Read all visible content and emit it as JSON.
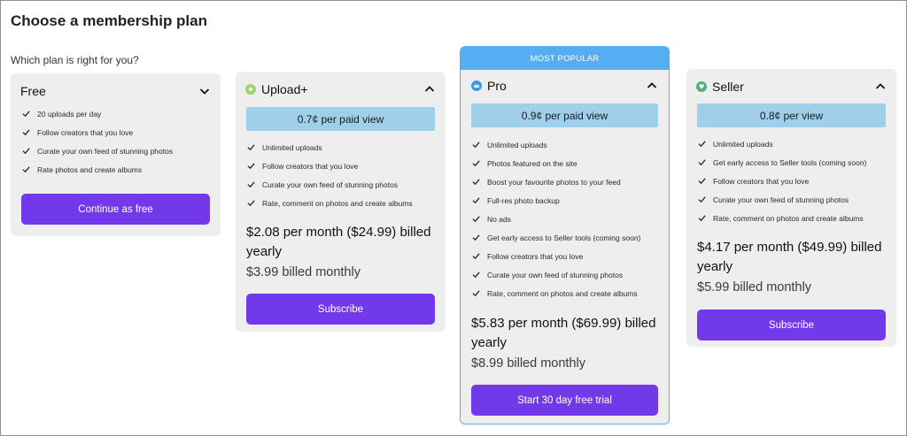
{
  "page": {
    "title": "Choose a membership plan",
    "subtitle": "Which plan is right for you?"
  },
  "plans": [
    {
      "name": "Free",
      "expanded": false,
      "features": [
        "20 uploads per day",
        "Follow creators that you love",
        "Curate your own feed of stunning photos",
        "Rate photos and create albums"
      ],
      "cta": "Continue as free"
    },
    {
      "name": "Upload+",
      "icon": "plus-circle-icon",
      "icon_color": "#9fd36b",
      "expanded": true,
      "per_view": "0.7¢ per paid view",
      "features": [
        "Unlimited uploads",
        "Follow creators that you love",
        "Curate your own feed of stunning photos",
        "Rate, comment on photos and create albums"
      ],
      "price_yearly": "$2.08 per month ($24.99) billed yearly",
      "price_monthly": "$3.99 billed monthly",
      "cta": "Subscribe"
    },
    {
      "name": "Pro",
      "icon": "crown-icon",
      "icon_color": "#3a9be6",
      "badge": "MOST POPULAR",
      "expanded": true,
      "per_view": "0.9¢ per paid view",
      "features": [
        "Unlimited uploads",
        "Photos featured on the site",
        "Boost your favourite photos to your feed",
        "Full-res photo backup",
        "No ads",
        "Get early access to Seller tools (coming soon)",
        "Follow creators that you love",
        "Curate your own feed of stunning photos",
        "Rate, comment on photos and create albums"
      ],
      "price_yearly": "$5.83 per month ($69.99) billed yearly",
      "price_monthly": "$8.99 billed monthly",
      "cta": "Start 30 day free trial"
    },
    {
      "name": "Seller",
      "icon": "tag-icon",
      "icon_color": "#4caf7a",
      "expanded": true,
      "per_view": "0.8¢ per view",
      "features": [
        "Unlimited uploads",
        "Get early access to Seller tools (coming soon)",
        "Follow creators that you love",
        "Curate your own feed of stunning photos",
        "Rate, comment on photos and create albums"
      ],
      "price_yearly": "$4.17 per month ($49.99) billed yearly",
      "price_monthly": "$5.99 billed monthly",
      "cta": "Subscribe"
    }
  ],
  "colors": {
    "accent": "#7239ea",
    "price_band": "#9fcfeb",
    "popular_banner": "#56aef2",
    "card_bg": "#eeeeef"
  }
}
